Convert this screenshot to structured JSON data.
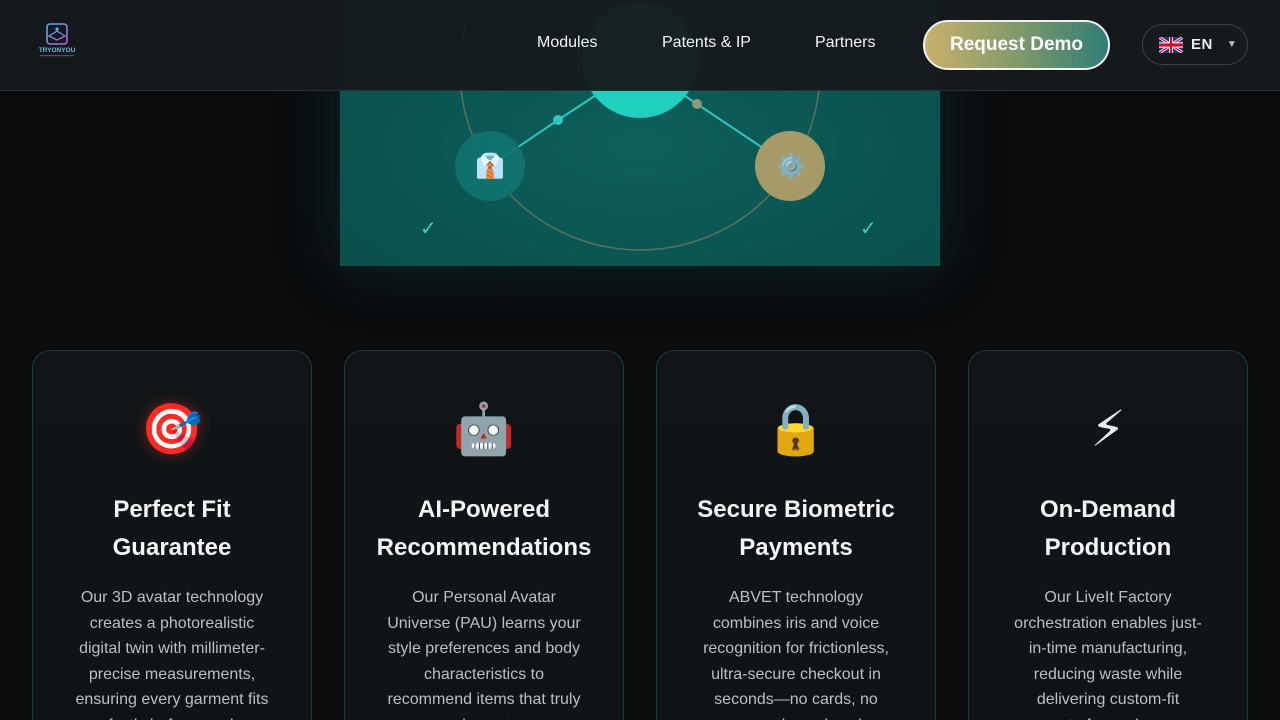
{
  "header": {
    "logo_text": "TRYONYOU",
    "nav": [
      {
        "label": "Modules"
      },
      {
        "label": "Patents & IP"
      },
      {
        "label": "Partners"
      }
    ],
    "cta_label": "Request Demo",
    "language": {
      "code": "EN",
      "flag_icon": "uk-flag-icon"
    }
  },
  "hero": {
    "icons": [
      "necktie-icon",
      "gear-icon"
    ],
    "checkmarks": [
      "✓",
      "✓"
    ],
    "accent": "#38d0c6"
  },
  "features": [
    {
      "icon": "🎯",
      "icon_name": "target-icon",
      "title": "Perfect Fit Guarantee",
      "description": "Our 3D avatar technology creates a photorealistic digital twin with millimeter-precise measurements, ensuring every garment fits perfectly before you buy."
    },
    {
      "icon": "🤖",
      "icon_name": "robot-icon",
      "title": "AI-Powered Recommendations",
      "description": "Our Personal Avatar Universe (PAU) learns your style preferences and body characteristics to recommend items that truly complement you."
    },
    {
      "icon": "🔒",
      "icon_name": "lock-icon",
      "title": "Secure Biometric Payments",
      "description": "ABVET technology combines iris and voice recognition for frictionless, ultra-secure checkout in seconds—no cards, no passwords, no hassle."
    },
    {
      "icon": "⚡",
      "icon_name": "lightning-icon",
      "title": "On-Demand Production",
      "description": "Our LiveIt Factory orchestration enables just-in-time manufacturing, reducing waste while delivering custom-fit garments faster than ever."
    }
  ]
}
